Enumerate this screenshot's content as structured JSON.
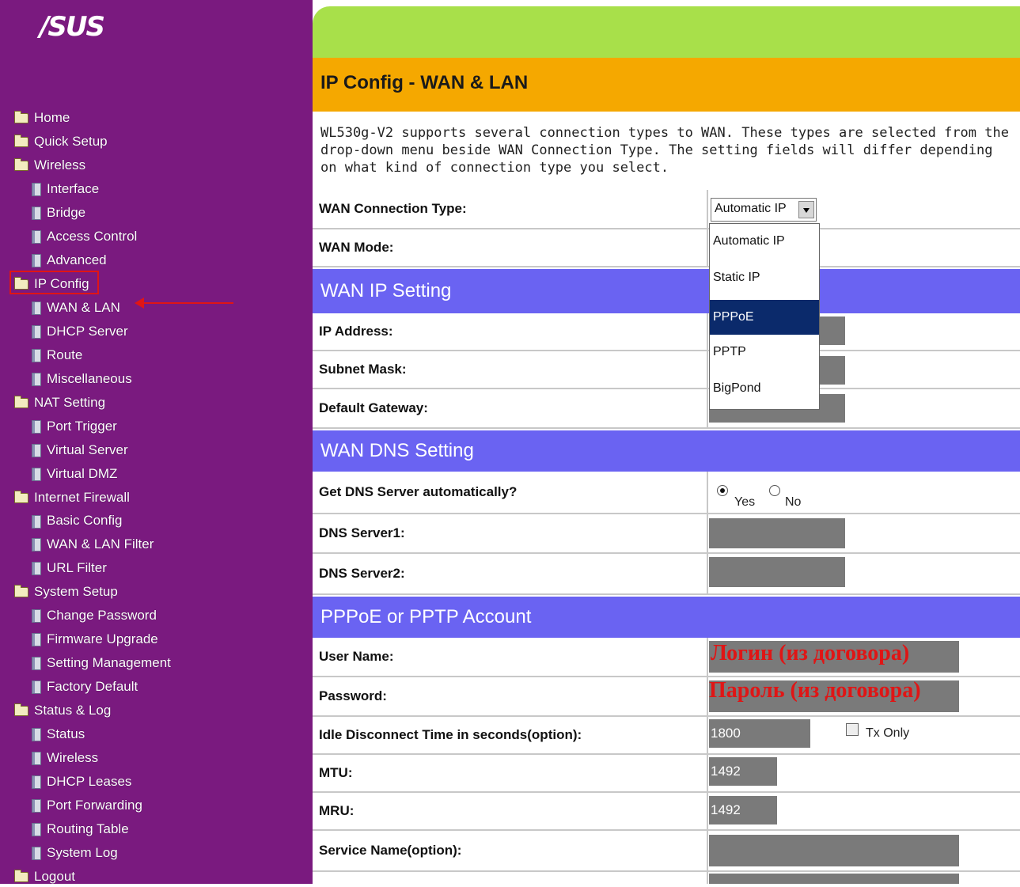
{
  "brand": {
    "logo": "/SUS"
  },
  "sidebar": {
    "items": [
      {
        "label": "Home",
        "type": "folder"
      },
      {
        "label": "Quick Setup",
        "type": "folder"
      },
      {
        "label": "Wireless",
        "type": "folder"
      },
      {
        "label": "Interface",
        "type": "doc"
      },
      {
        "label": "Bridge",
        "type": "doc"
      },
      {
        "label": "Access Control",
        "type": "doc"
      },
      {
        "label": "Advanced",
        "type": "doc"
      },
      {
        "label": "IP Config",
        "type": "folder"
      },
      {
        "label": "WAN & LAN",
        "type": "doc"
      },
      {
        "label": "DHCP Server",
        "type": "doc"
      },
      {
        "label": "Route",
        "type": "doc"
      },
      {
        "label": "Miscellaneous",
        "type": "doc"
      },
      {
        "label": "NAT Setting",
        "type": "folder"
      },
      {
        "label": "Port Trigger",
        "type": "doc"
      },
      {
        "label": "Virtual Server",
        "type": "doc"
      },
      {
        "label": "Virtual DMZ",
        "type": "doc"
      },
      {
        "label": "Internet Firewall",
        "type": "folder"
      },
      {
        "label": "Basic Config",
        "type": "doc"
      },
      {
        "label": "WAN & LAN Filter",
        "type": "doc"
      },
      {
        "label": "URL Filter",
        "type": "doc"
      },
      {
        "label": "System Setup",
        "type": "folder"
      },
      {
        "label": "Change Password",
        "type": "doc"
      },
      {
        "label": "Firmware Upgrade",
        "type": "doc"
      },
      {
        "label": "Setting Management",
        "type": "doc"
      },
      {
        "label": "Factory Default",
        "type": "doc"
      },
      {
        "label": "Status & Log",
        "type": "folder"
      },
      {
        "label": "Status",
        "type": "doc"
      },
      {
        "label": "Wireless",
        "type": "doc"
      },
      {
        "label": "DHCP Leases",
        "type": "doc"
      },
      {
        "label": "Port Forwarding",
        "type": "doc"
      },
      {
        "label": "Routing Table",
        "type": "doc"
      },
      {
        "label": "System Log",
        "type": "doc"
      },
      {
        "label": "Logout",
        "type": "folder"
      }
    ]
  },
  "page": {
    "title": "IP Config - WAN & LAN",
    "intro": "WL530g-V2 supports several connection types to WAN. These types are selected from the drop-down menu beside WAN Connection Type. The setting fields will differ depending on what kind of connection type you select."
  },
  "wan": {
    "conn_type_label": "WAN Connection Type:",
    "conn_type_value": "Automatic IP",
    "options": [
      "Automatic IP",
      "Static IP",
      "PPPoE",
      "PPTP",
      "BigPond"
    ],
    "selected_option": "PPPoE",
    "mode_label": "WAN Mode:"
  },
  "wan_ip": {
    "title": "WAN IP Setting",
    "ip_label": "IP Address:",
    "subnet_label": "Subnet Mask:",
    "gateway_label": "Default Gateway:"
  },
  "wan_dns": {
    "title": "WAN DNS Setting",
    "auto_label": "Get DNS Server automatically?",
    "yes": "Yes",
    "no": "No",
    "dns1_label": "DNS Server1:",
    "dns2_label": "DNS Server2:"
  },
  "account": {
    "title": "PPPoE or PPTP Account",
    "user_label": "User Name:",
    "user_value": "Логин (из договора)",
    "pass_label": "Password:",
    "pass_value": "Пароль (из договора)",
    "idle_label": "Idle Disconnect Time in seconds(option):",
    "idle_value": "1800",
    "tx_only": "Tx Only",
    "mtu_label": "MTU:",
    "mtu_value": "1492",
    "mru_label": "MRU:",
    "mru_value": "1492",
    "service_label": "Service Name(option):"
  },
  "colors": {
    "sidebar": "#7a1a7f",
    "banner": "#a8e04a",
    "title_bar": "#f5a800",
    "section": "#6a63f2",
    "highlight": "#e01515"
  }
}
